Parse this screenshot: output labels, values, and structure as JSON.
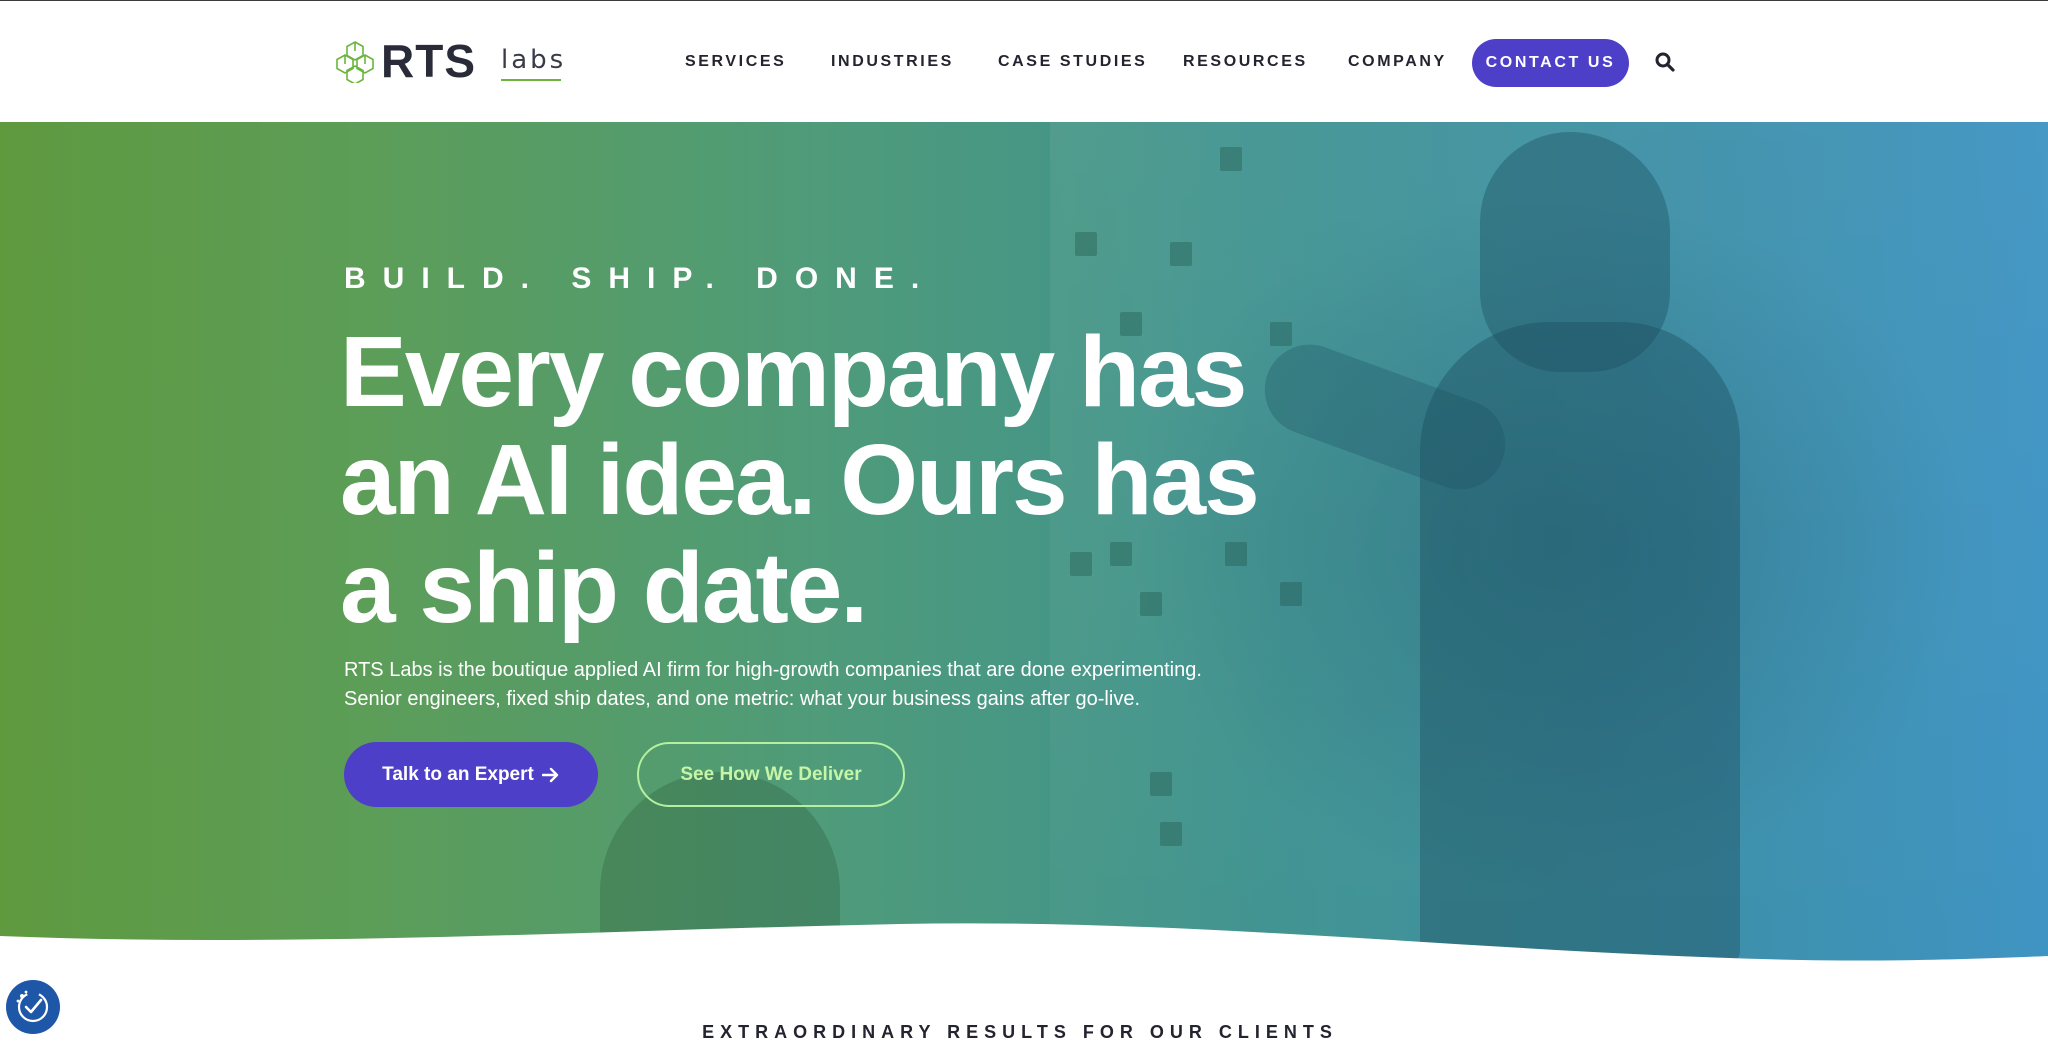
{
  "header": {
    "logo": {
      "wordmark": "RTS",
      "suffix": "labs"
    },
    "nav": [
      "SERVICES",
      "INDUSTRIES",
      "CASE STUDIES",
      "RESOURCES",
      "COMPANY"
    ],
    "contact_label": "CONTACT US",
    "search_icon": "search-icon"
  },
  "hero": {
    "tagline": "BUILD. SHIP. DONE.",
    "headline_lines": [
      "Every company has",
      "an AI idea. Ours has",
      "a ship date."
    ],
    "subcopy_lines": [
      "RTS Labs is the boutique applied AI firm for high-growth companies that are done experimenting.",
      "Senior engineers, fixed ship dates, and one metric: what your business gains after go-live."
    ],
    "primary_cta": "Talk to an Expert",
    "primary_cta_icon": "arrow-right-icon",
    "secondary_cta": "See How We Deliver"
  },
  "results": {
    "label": "EXTRAORDINARY RESULTS FOR OUR CLIENTS"
  },
  "privacy": {
    "icon": "privacy-check-icon"
  },
  "colors": {
    "brand_purple": "#4e3fc9",
    "brand_green": "#6bb53a",
    "hero_gradient_start": "#5f9a3f",
    "hero_gradient_end": "#3b92c2",
    "secondary_cta_outline": "#b4f0a0",
    "text_dark": "#23242f"
  }
}
